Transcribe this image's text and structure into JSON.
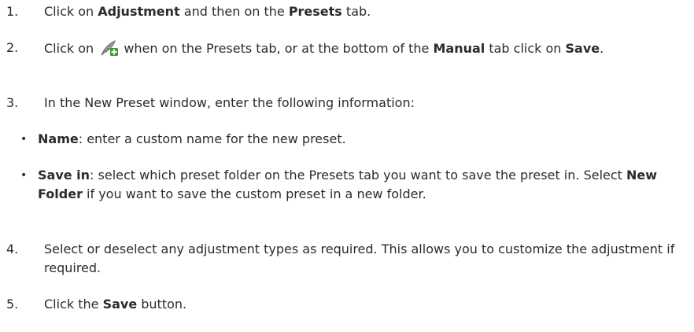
{
  "steps": [
    {
      "num": "1.",
      "parts": [
        "Click on ",
        "Adjustment",
        " and then on the ",
        "Presets",
        " tab."
      ]
    },
    {
      "num": "2.",
      "parts": [
        "Click on ",
        " when on the Presets tab, or at the bottom of the ",
        "Manual",
        " tab click on ",
        "Save",
        "."
      ],
      "icon": "new-preset-feather-plus-icon"
    },
    {
      "num": "3.",
      "parts": [
        "In the New Preset window, enter the following information:"
      ]
    },
    {
      "num": "4.",
      "parts": [
        "Select or deselect any adjustment types as required. This allows you to customize the adjustment if required."
      ]
    },
    {
      "num": "5.",
      "parts": [
        "Click the ",
        "Save",
        " button."
      ]
    }
  ],
  "bullets": [
    {
      "mark": "•",
      "parts": [
        "Name",
        ": enter a custom name for the new preset."
      ]
    },
    {
      "mark": "•",
      "parts": [
        "Save in",
        ": select which preset folder on the Presets tab you want to save the preset in. Select ",
        "New Folder",
        " if you want to save the custom preset in a new folder."
      ]
    }
  ],
  "colors": {
    "text": "#2b2b2b",
    "icon_gray": "#8a8a8a",
    "icon_green": "#3a9a3a"
  }
}
